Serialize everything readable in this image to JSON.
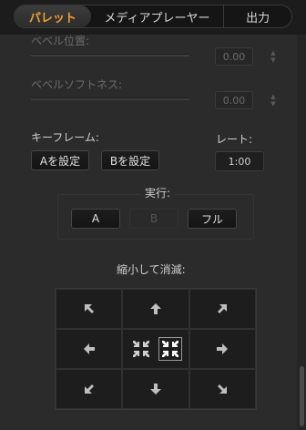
{
  "tabs": [
    "パレット",
    "メディアプレーヤー",
    "出力"
  ],
  "bevel_position": {
    "label": "ベベル位置:",
    "value": "0.00"
  },
  "bevel_softness": {
    "label": "ベベルソフトネス:",
    "value": "0.00"
  },
  "keyframe": {
    "label": "キーフレーム:",
    "set_a": "Aを設定",
    "set_b": "Bを設定"
  },
  "rate": {
    "label": "レート:",
    "value": "1:00"
  },
  "run": {
    "label": "実行:",
    "a": "A",
    "b": "B",
    "full": "フル"
  },
  "shrink": {
    "label": "縮小して消滅:"
  },
  "colors": {
    "accent": "#f0a030"
  }
}
